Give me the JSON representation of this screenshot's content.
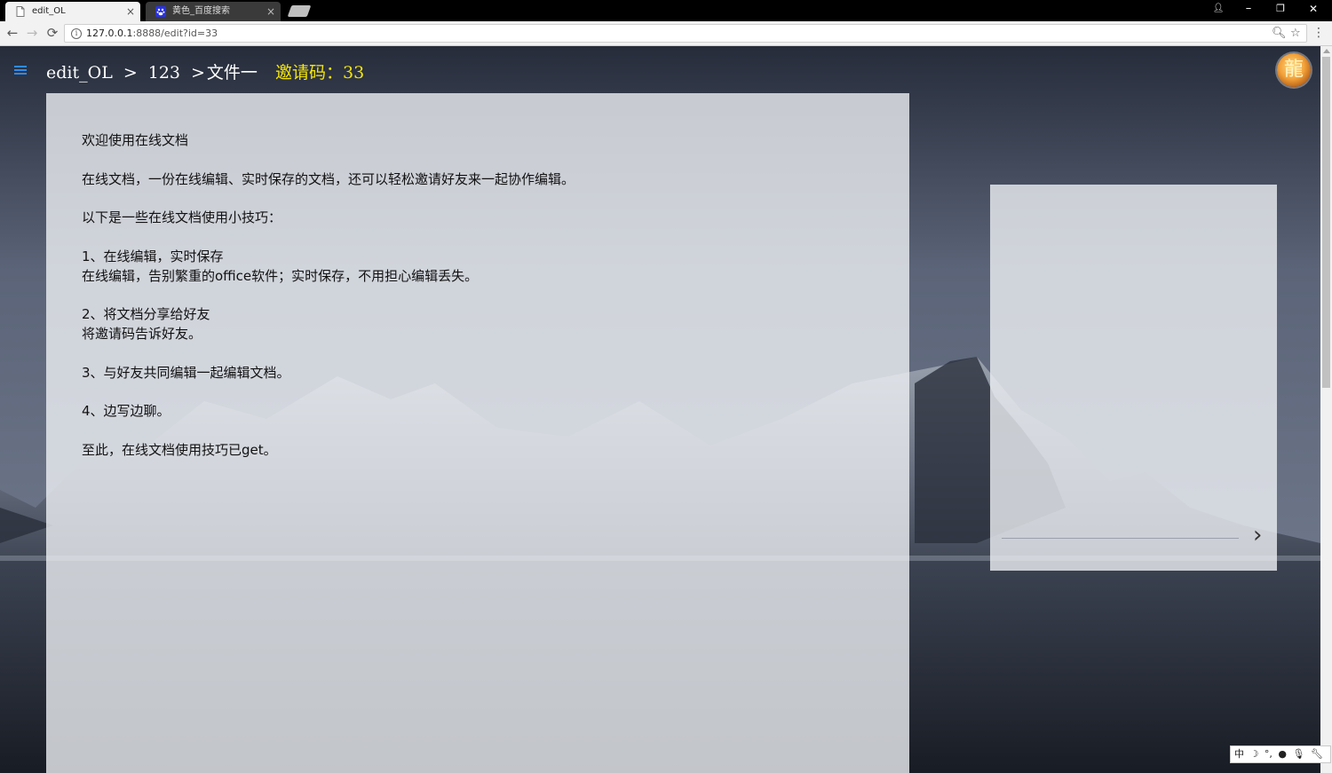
{
  "browser": {
    "tabs": [
      {
        "title": "edit_OL",
        "icon": "page-icon",
        "active": true
      },
      {
        "title": "黄色_百度搜索",
        "icon": "baidu-paw-icon",
        "active": false
      }
    ],
    "address": {
      "url_host": "127.0.0.1",
      "url_rest": ":8888/edit?id=33"
    },
    "icons": {
      "back": "←",
      "forward": "→",
      "reload": "⟳",
      "zoom": "🔍︎",
      "star": "☆",
      "menu": "⋮",
      "user": "👤︎",
      "minimize": "–",
      "restore": "❐",
      "close": "✕",
      "tab_close": "×"
    }
  },
  "page": {
    "breadcrumb": [
      "edit_OL",
      "123",
      "文件一"
    ],
    "separator": ">",
    "invite_label": "邀请码：33",
    "avatar_glyph": "龍",
    "document": {
      "paragraphs": [
        "欢迎使用在线文档",
        "在线文档，一份在线编辑、实时保存的文档，还可以轻松邀请好友来一起协作编辑。",
        "以下是一些在线文档使用小技巧：",
        "1、在线编辑，实时保存\n在线编辑，告别繁重的office软件；实时保存，不用担心编辑丢失。",
        "2、将文档分享给好友\n将邀请码告诉好友。",
        "3、与好友共同编辑一起编辑文档。",
        "4、边写边聊。",
        "至此，在线文档使用技巧已get。"
      ]
    },
    "side_panel": {
      "next_glyph": "›"
    }
  },
  "ime": {
    "items": [
      "中",
      "☽",
      "°,",
      "●",
      "🎙︎",
      "🔧︎"
    ]
  },
  "colors": {
    "invite": "#f5e60a",
    "menu_icon": "#2d8cf0",
    "panel": "rgba(238,240,244,0.8)"
  }
}
